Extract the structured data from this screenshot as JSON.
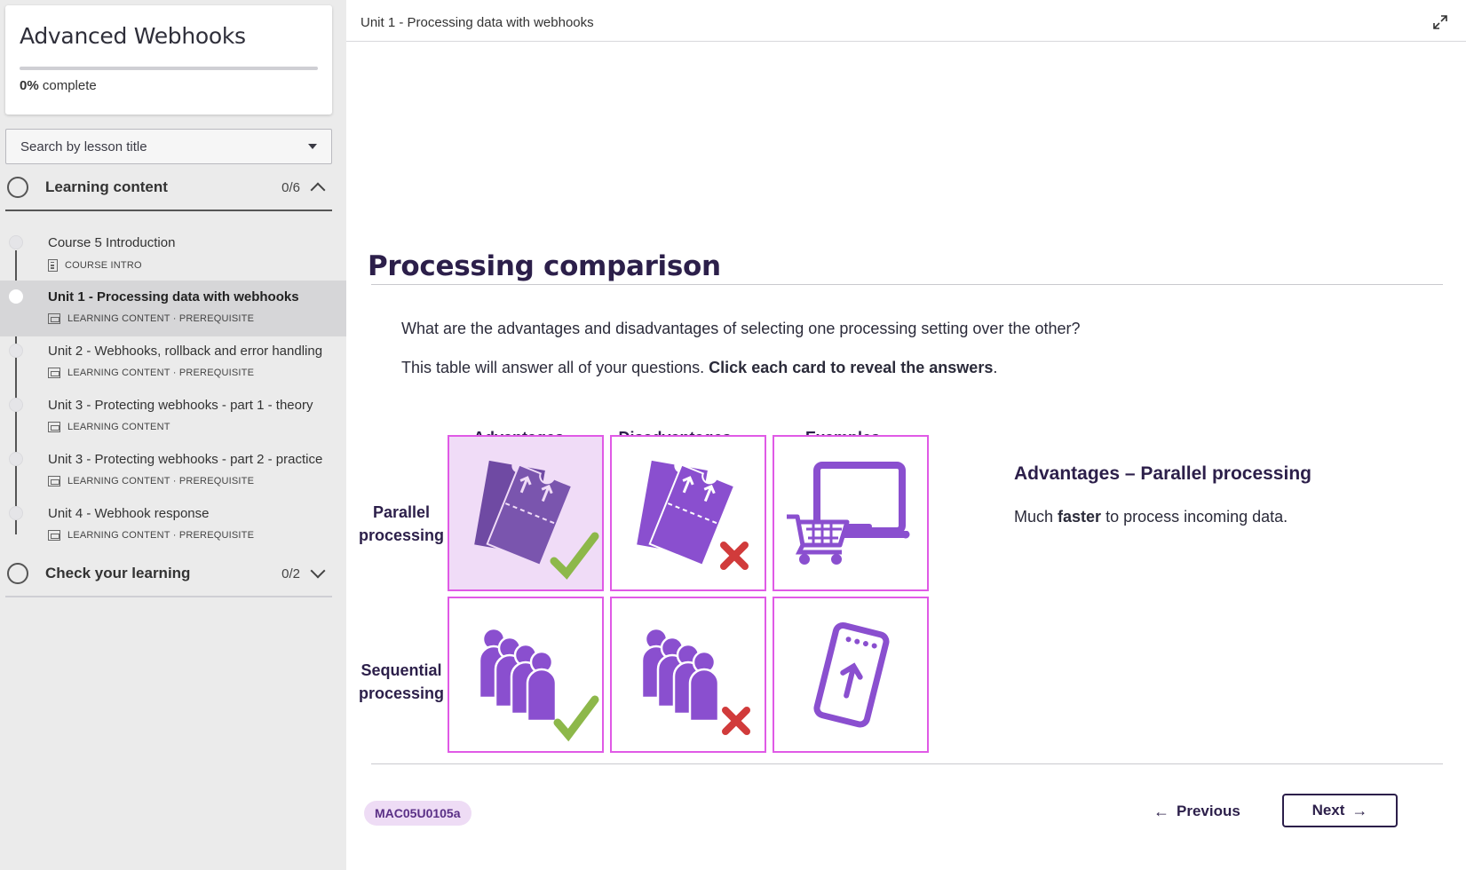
{
  "sidebar": {
    "course_title": "Advanced Webhooks",
    "progress_value": "0%",
    "progress_suffix": "complete",
    "progress_fraction": 0,
    "search_placeholder": "Search by lesson title",
    "sections": [
      {
        "label": "Learning content",
        "count": "0/6",
        "expanded": true,
        "lessons": [
          {
            "title": "Course 5 Introduction",
            "meta": "COURSE INTRO",
            "icon": "document-icon",
            "active": false
          },
          {
            "title": "Unit 1 - Processing data with webhooks",
            "meta": "LEARNING CONTENT · PREREQUISITE",
            "icon": "slides-icon",
            "active": true
          },
          {
            "title": "Unit 2 - Webhooks, rollback and error handling",
            "meta": "LEARNING CONTENT · PREREQUISITE",
            "icon": "slides-icon",
            "active": false
          },
          {
            "title": "Unit 3 - Protecting webhooks - part 1 - theory",
            "meta": "LEARNING CONTENT",
            "icon": "slides-icon",
            "active": false
          },
          {
            "title": "Unit 3 - Protecting webhooks - part 2 - practice",
            "meta": "LEARNING CONTENT · PREREQUISITE",
            "icon": "slides-icon",
            "active": false
          },
          {
            "title": "Unit 4 - Webhook response",
            "meta": "LEARNING CONTENT · PREREQUISITE",
            "icon": "slides-icon",
            "active": false
          }
        ]
      },
      {
        "label": "Check your learning",
        "count": "0/2",
        "expanded": false
      }
    ]
  },
  "main": {
    "topbar_title": "Unit 1 - Processing data with webhooks",
    "heading": "Processing comparison",
    "question": "What are the advantages and disadvantages of selecting one processing setting over the other?",
    "instruction_plain": "This table will answer all of your questions. ",
    "instruction_bold": "Click each card to reveal the answers",
    "instruction_end": ".",
    "columns": [
      "Advantages",
      "Disadvantages",
      "Examples"
    ],
    "rows": [
      {
        "line1": "Parallel",
        "line2": "processing"
      },
      {
        "line1": "Sequential",
        "line2": "processing"
      }
    ],
    "cards": [
      {
        "id": "parallel-advantages",
        "icon": "tickets-check-icon",
        "selected": true
      },
      {
        "id": "parallel-disadvantages",
        "icon": "tickets-cross-icon",
        "selected": false
      },
      {
        "id": "parallel-examples",
        "icon": "cart-laptop-icon",
        "selected": false
      },
      {
        "id": "sequential-advantages",
        "icon": "queue-check-icon",
        "selected": false
      },
      {
        "id": "sequential-disadvantages",
        "icon": "queue-cross-icon",
        "selected": false
      },
      {
        "id": "sequential-examples",
        "icon": "phone-upload-icon",
        "selected": false
      }
    ],
    "reveal": {
      "title": "Advantages – Parallel processing",
      "body_pre": "Much ",
      "body_bold": "faster",
      "body_post": " to process incoming data."
    },
    "code": "MAC05U0105a",
    "previous_label": "Previous",
    "next_label": "Next"
  },
  "colors": {
    "accent_purple": "#8a4fcf",
    "card_border": "#e05ae6",
    "check_green": "#8db84a",
    "cross_red": "#d13b3b",
    "heading_dark": "#2c1f4a"
  }
}
